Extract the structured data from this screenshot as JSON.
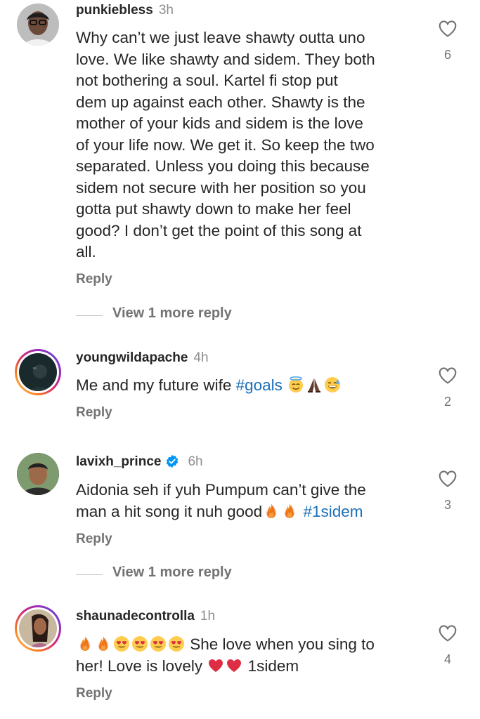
{
  "comments": [
    {
      "username": "punkiebless",
      "time": "3h",
      "lines": [
        "Why can’t we just leave shawty outta uno",
        "love. We like shawty and sidem. They both",
        "not bothering a soul. Kartel fi stop put",
        "dem up against each other. Shawty is the",
        "mother of your kids and sidem is the love",
        "of your life now. We get it. So keep the two",
        "separated. Unless you doing this because",
        "sidem not secure with her position so you",
        "gotta put shawty down to make her feel",
        "good? I don’t get the point of this song at",
        "all."
      ],
      "reply_label": "Reply",
      "likes": "6",
      "view_more": "View 1 more reply"
    },
    {
      "username": "youngwildapache",
      "time": "4h",
      "text": "Me and my future wife ",
      "hashtag": "#goals",
      "emoji": [
        "smiling-face-with-halo",
        "folded-hands",
        "grinning-face-with-sweat"
      ],
      "reply_label": "Reply",
      "likes": "2"
    },
    {
      "username": "lavixh_prince",
      "time": "6h",
      "verified": true,
      "line1": "Aidonia seh if yuh Pumpum can’t give the",
      "line2": "man a hit song it nuh good",
      "emoji": [
        "fire",
        "fire"
      ],
      "hashtag": "#1sidem",
      "reply_label": "Reply",
      "likes": "3",
      "view_more": "View 1 more reply"
    },
    {
      "username": "shaunadecontrolla",
      "time": "1h",
      "emoji_lead": [
        "fire",
        "fire",
        "smiling-face-with-heart-eyes",
        "smiling-face-with-heart-eyes",
        "smiling-face-with-heart-eyes",
        "smiling-face-with-heart-eyes"
      ],
      "text1": " She love when you sing to",
      "text2": "her! Love is lovely ",
      "emoji_mid": [
        "red-heart",
        "red-heart"
      ],
      "text3": " 1sidem",
      "reply_label": "Reply",
      "likes": "4"
    }
  ],
  "colors": {
    "hashtag": "#1a6fb8",
    "verified": "#0095f6",
    "muted": "#737373"
  }
}
